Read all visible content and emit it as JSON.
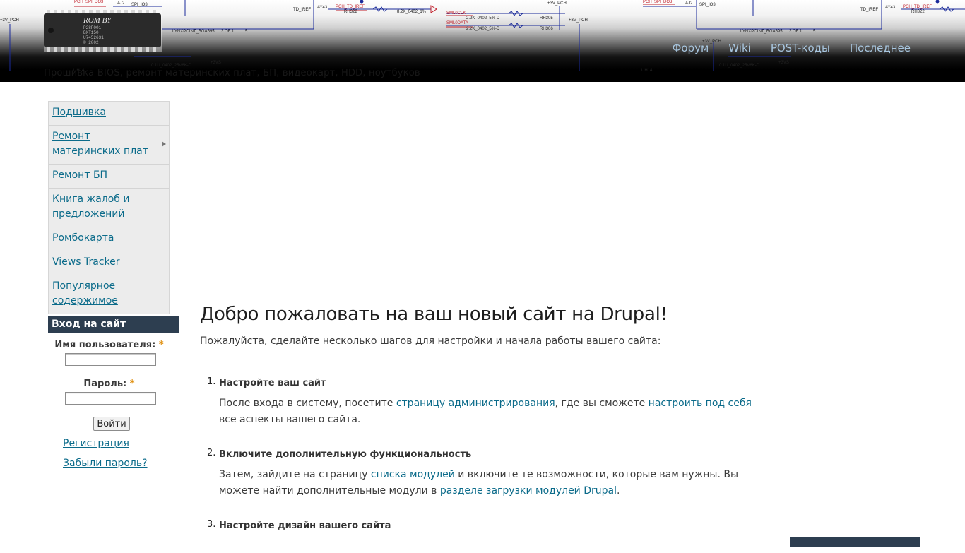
{
  "header": {
    "slogan": "Прошивка BIOS, ремонт материнских плат, БП, видеокарт, HDD, ноутбуков",
    "chip_marking": "ROM BY",
    "schematic_labels": [
      "PCH_SPI_DO3",
      "AJ2",
      "SPI_IO3",
      "TD_IREF",
      "AY43",
      "PCH_TD_IREF",
      "RH322",
      "8.2K_0402_1%",
      "+3V_PCH",
      "SML0CLK",
      "SML0DATA",
      "2.2K_0402_5%-D",
      "RH305",
      "RH306",
      "LYNXPOINT_BGA695",
      "3 OF 11",
      "0.1U_0402_25V6K-D",
      "+3VS",
      "UH14"
    ],
    "menu": [
      "Форум",
      "Wiki",
      "POST-коды",
      "Последнее"
    ]
  },
  "sidebar": {
    "menu": [
      {
        "label": "Подшивка",
        "expandable": false
      },
      {
        "label": "Ремонт материнских плат",
        "expandable": true
      },
      {
        "label": "Ремонт БП",
        "expandable": false
      },
      {
        "label": "Книга жалоб и предложений",
        "expandable": false
      },
      {
        "label": "Ромбокарта",
        "expandable": false
      },
      {
        "label": "Views Tracker",
        "expandable": false
      },
      {
        "label": "Популярное содержимое",
        "expandable": false
      }
    ],
    "login": {
      "title": "Вход на сайт",
      "username_label": "Имя пользователя:",
      "username_value": "",
      "password_label": "Пароль:",
      "password_value": "",
      "required_marker": "*",
      "submit_label": "Войти",
      "register_link": "Регистрация",
      "forgot_link": "Забыли пароль?"
    }
  },
  "content": {
    "title": "Добро пожаловать на ваш новый сайт на Drupal!",
    "intro": "Пожалуйста, сделайте несколько шагов для настройки и начала работы вашего сайта:",
    "steps": [
      {
        "number": "1.",
        "title": "Настройте ваш сайт",
        "parts": {
          "t1": "После входа в систему, посетите ",
          "l1": "страницу администрирования",
          "t2": ", где вы сможете ",
          "l2": "настроить под себя",
          "t3": " все аспекты вашего сайта."
        }
      },
      {
        "number": "2.",
        "title": "Включите дополнительную функциональность",
        "parts": {
          "t1": "Затем, зайдите на страницу ",
          "l1": "списка модулей",
          "t2": " и включите те возможности, которые вам нужны. Вы можете найти дополнительные модули в ",
          "l2": "разделе загрузки модулей Drupal",
          "t3": "."
        }
      },
      {
        "number": "3.",
        "title": "Настройте дизайн вашего сайта"
      }
    ]
  },
  "right_block": {
    "title": ""
  },
  "colors": {
    "link": "#0b6b8a",
    "block_header_bg": "#2d3e50",
    "menu_link": "#a8c6df",
    "required": "#e09010"
  }
}
